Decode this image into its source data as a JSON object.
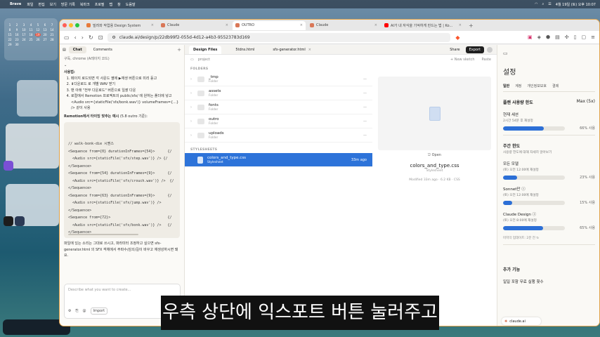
{
  "menubar": {
    "app": "Brave",
    "items": [
      "파일",
      "편집",
      "보기",
      "방문 기록",
      "북마크",
      "프로필",
      "탭",
      "창",
      "도움말"
    ],
    "clock": "4월 19일 (토) 오후 10:07"
  },
  "desktop": {
    "calendar_days": [
      "1",
      "2",
      "3",
      "4",
      "5",
      "6",
      "7",
      "8",
      "9",
      "10",
      "11",
      "12",
      "13",
      "14",
      "15",
      "16",
      "17",
      "18",
      "19",
      "20",
      "21",
      "22",
      "23",
      "24",
      "25",
      "26",
      "27",
      "28",
      "29",
      "30"
    ],
    "calendar_today": "19"
  },
  "browser": {
    "tabs": [
      {
        "title": "빌려와 작업용 Design System",
        "active": false,
        "color": "#e77a3b"
      },
      {
        "title": "Claude",
        "active": false,
        "color": "#d97757"
      },
      {
        "title": "OUTRO",
        "active": true,
        "color": "#d97757"
      },
      {
        "title": "Claude",
        "active": false,
        "color": "#d97757"
      },
      {
        "title": "AI가 내 자식을 기억하게 만드는 법 | Ko...",
        "active": false,
        "color": "#ff0000"
      }
    ],
    "url": "claude.ai/design/p/22db99f2-055d-4d12-a4b3-95523783d169"
  },
  "chat": {
    "tab_chat": "Chat",
    "tab_comments": "Comments",
    "subtitle_line": "구독. chrome (A레이지 코드)",
    "usage_heading": "사용법:",
    "steps": [
      "페이지 로드되면 각 사운드 옆에 ▶재생 버튼으로 미리 듣고",
      "⬇다운로드 로 개별 WAV 받기",
      "맨 아래 \"전부 다운로드\" 버튼으로 일괄 다운",
      "로컬에서 Remotion 프로젝트의 public/sfx/ 에 원하는 폴더에 넣고 <Audio src={staticFile('sfx/bonk.wav')} volumeFrames={...} /> 같이 사용"
    ],
    "example_heading": "Remotion에서 타이밍 맞추는 예시",
    "example_note": "(5.8 outro 기준):",
    "code": "// walk-bonk-die 시퀀스\n<Sequence from={0} durationInFrames={54}>      {/\n  <Audio src={staticFile('sfx/step.wav')} /> {/\n</Sequence>\n<Sequence from={54} durationInFrames={9}>      {/\n  <Audio src={staticFile('sfx/crouch.wav')} />  {/\n</Sequence>\n<Sequence from={63} durationInFrames={9}>      {/\n  <Audio src={staticFile('sfx/jump.wav')} />\n</Sequence>\n<Sequence from={72}>                           {/\n  <Audio src={staticFile('sfx/bonk.wav')} />   {/\n</Sequence>\n<Sequence from={99}>                           {/\n  <Audio src={staticFile('sfx/thud.wav')} />   {/\n</Sequence>",
    "footer_text": "파일에 있는 소리는 그대로 쓰시고, 파라미터 조정하고 싶으면 sfx-generator.html 의 SFX 객체에서 주파수/감쇠/길이 바꾸고 재생성하시면 돼요.",
    "input_placeholder": "Describe what you want to create...",
    "import_label": "Import"
  },
  "files": {
    "tabs": [
      {
        "label": "Design Files",
        "active": true
      },
      {
        "label": "5tdns.html",
        "active": false
      },
      {
        "label": "sfx-generator.html",
        "active": false
      }
    ],
    "breadcrumb": "project",
    "new_sketch": "+ New sketch",
    "paste": "Paste",
    "share": "Share",
    "export": "Export",
    "folders_label": "FOLDERS",
    "folders": [
      {
        "name": "_tmp",
        "kind": "Folder",
        "meta": "—"
      },
      {
        "name": "assets",
        "kind": "Folder",
        "meta": "—"
      },
      {
        "name": "fonts",
        "kind": "Folder",
        "meta": "—"
      },
      {
        "name": "outro",
        "kind": "Folder",
        "meta": "—"
      },
      {
        "name": "uploads",
        "kind": "Folder",
        "meta": "—"
      }
    ],
    "stylesheets_label": "STYLESHEETS",
    "stylesheets": [
      {
        "name": "colors_and_type.css",
        "kind": "Stylesheet",
        "meta": "33m ago"
      }
    ],
    "preview": {
      "open": "Open",
      "name": "colors_and_type.css",
      "type": "Stylesheet",
      "meta": "Modified 33m ago · 6.2 KB · CSS"
    }
  },
  "settings": {
    "title": "설정",
    "tabs": [
      "일반",
      "계정",
      "개인정보보호",
      "결제"
    ],
    "plan_label": "플랜 사용량 한도",
    "plan_value": "Max (5x)",
    "session_title": "현재 세션",
    "session_sub": "2시간 54분 후 재설정",
    "session_pct": "66% 사용",
    "session_fill": 66,
    "weekly_title": "주간 한도",
    "weekly_sub": "사용량 한도에 대해 자세히 알아보기",
    "all_models_title": "모든 모델",
    "all_models_sub": "(토) 오전 12:00에 재설정",
    "all_models_pct": "23% 사용",
    "all_models_fill": 23,
    "sonnet_title": "Sonnet만",
    "sonnet_sub": "(토) 오전 12:00에 재설정",
    "sonnet_pct": "15% 사용",
    "sonnet_fill": 15,
    "design_title": "Claude Design",
    "design_sub": "(토) 오전 8:00에 재설정",
    "design_pct": "65% 사용",
    "design_fill": 65,
    "last_updated": "마지막 업데이트: 2분 전",
    "extra_title": "추가 기능",
    "extra_item": "일일 포함 무료 실행 횟수",
    "badge": "claude.ai"
  },
  "caption": "우측 상단에 익스포트 버튼 눌러주고요"
}
